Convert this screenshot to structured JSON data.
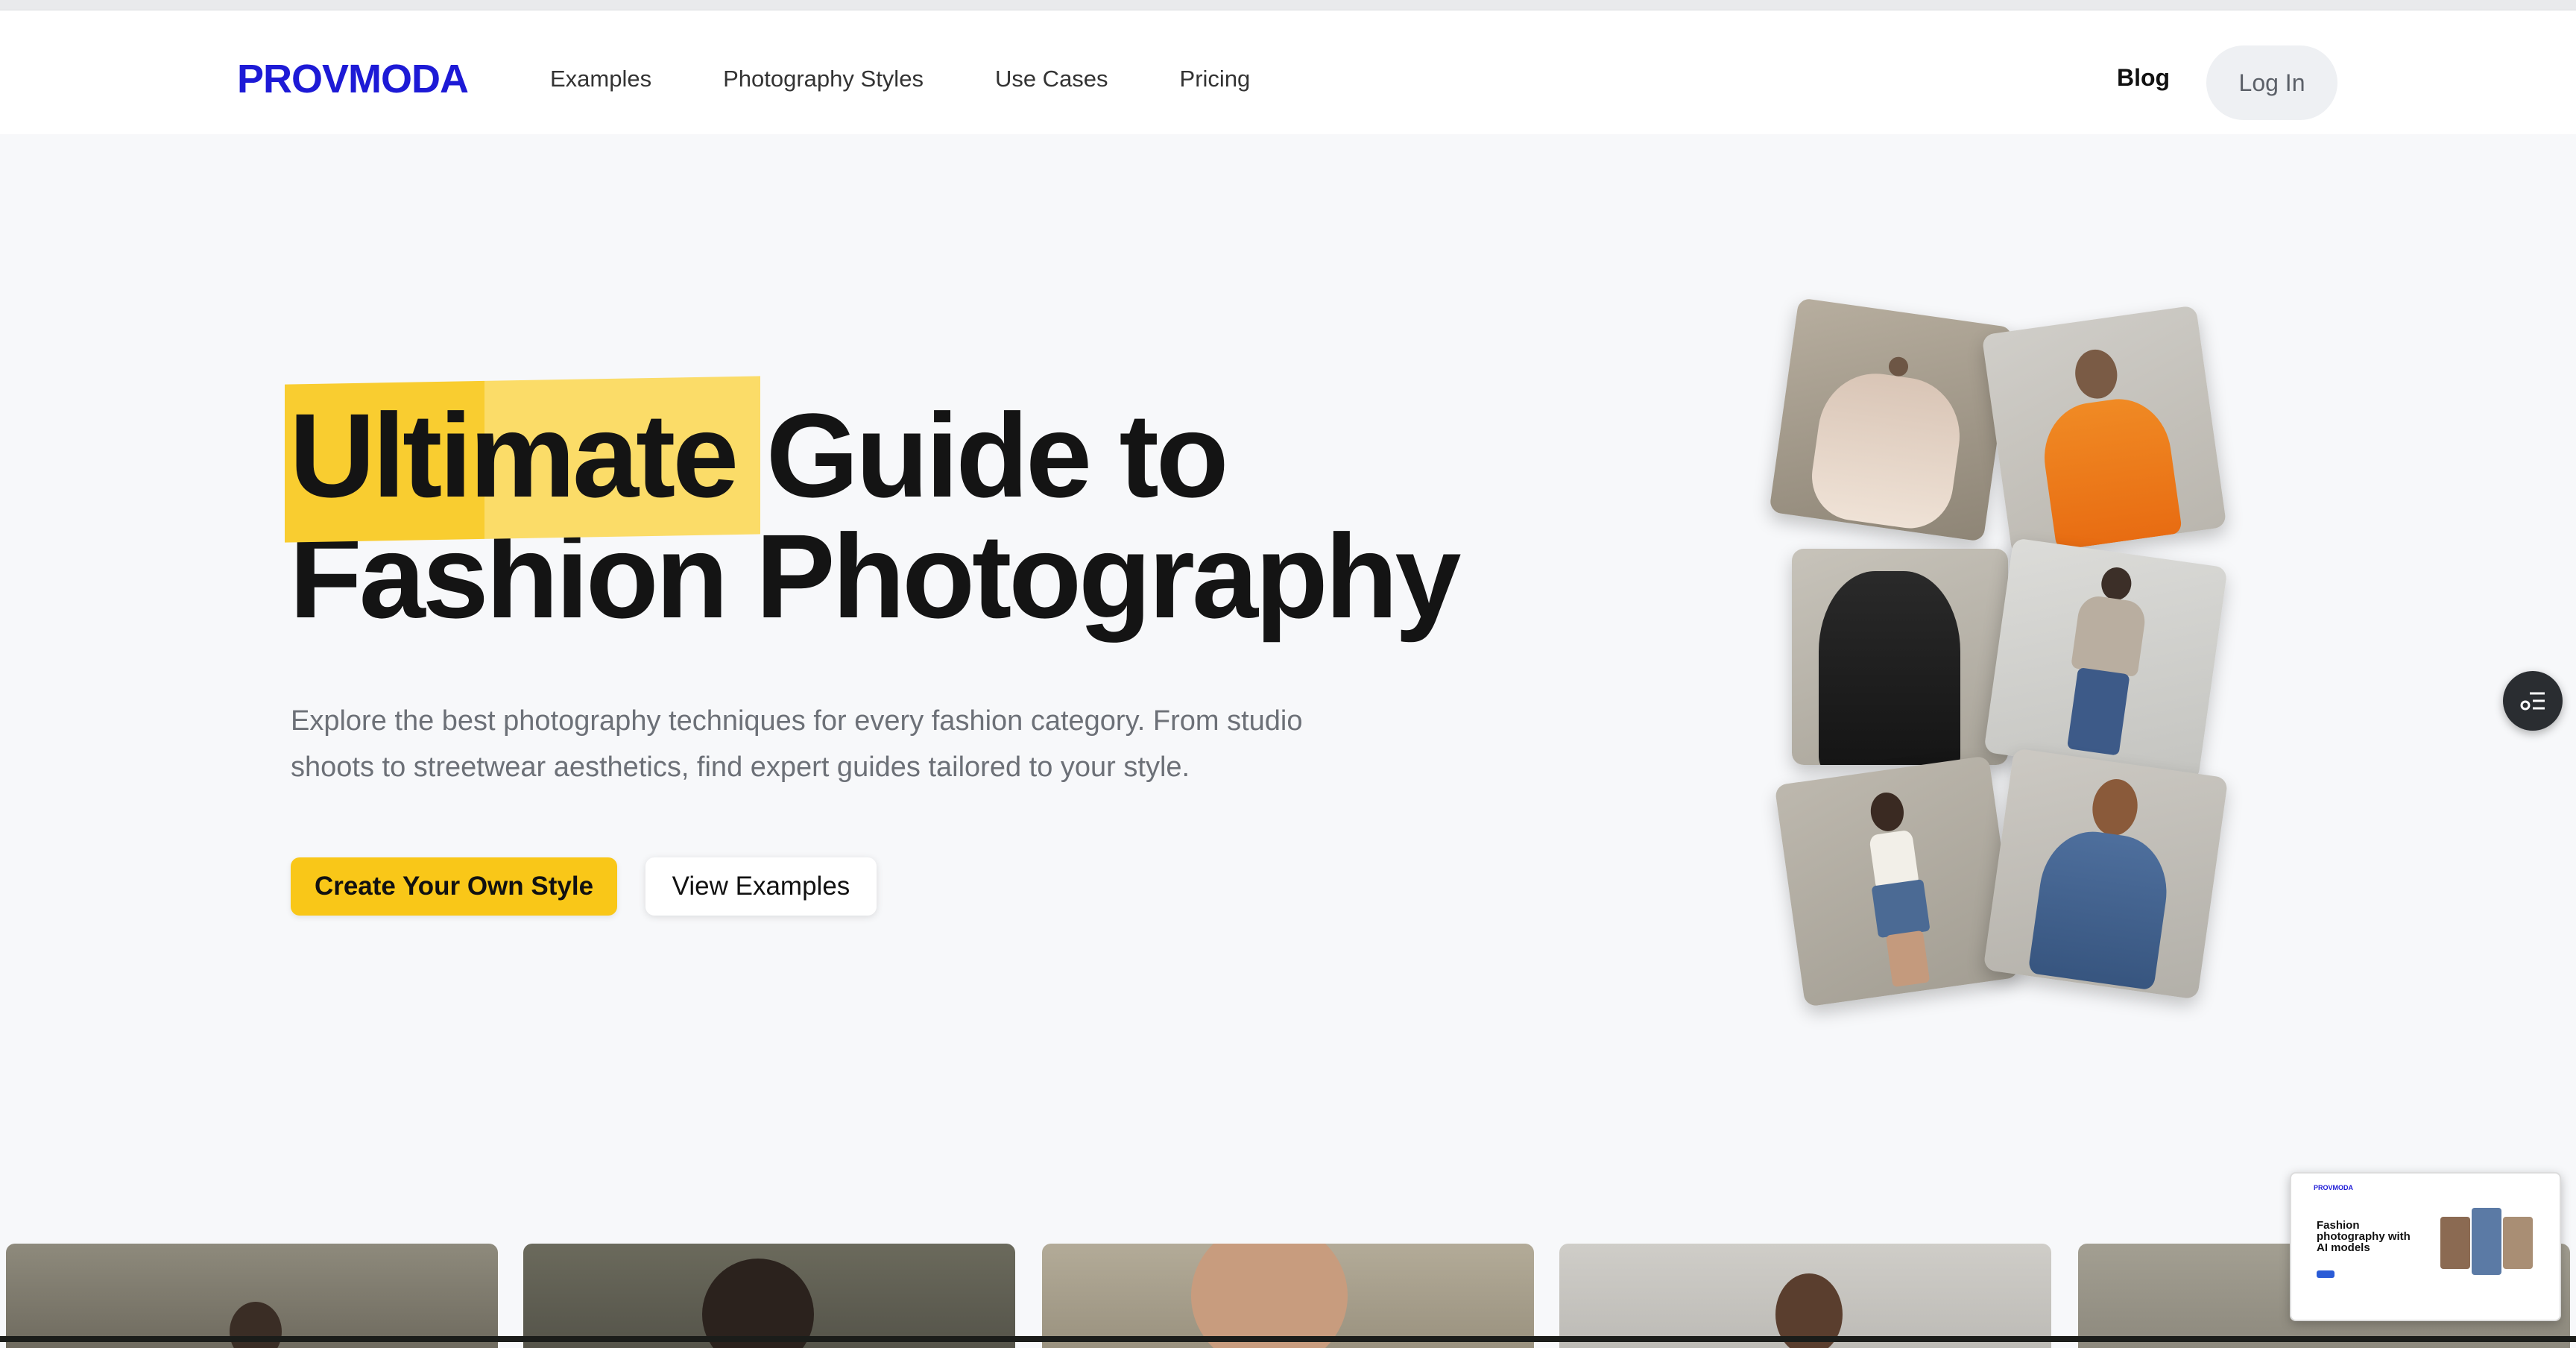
{
  "header": {
    "logo": "PROVMODA",
    "nav": [
      "Examples",
      "Photography Styles",
      "Use Cases",
      "Pricing"
    ],
    "blog": "Blog",
    "login": "Log In"
  },
  "hero": {
    "title_highlight": "Ultimate",
    "title_rest_line1": " Guide to",
    "title_line2": "Fashion Photography",
    "subtitle": "Explore the best photography techniques for every fashion category. From studio shoots to streetwear aesthetics, find expert guides tailored to your style.",
    "primary_button": "Create Your Own Style",
    "secondary_button": "View Examples"
  },
  "preview": {
    "logo": "PROVMODA",
    "title": "Fashion photography with AI models"
  },
  "colors": {
    "brand": "#1d1ad6",
    "accent_yellow": "#f9c718",
    "page_bg": "#f7f8fa"
  },
  "icons": {
    "side_button": "list-settings-icon"
  }
}
